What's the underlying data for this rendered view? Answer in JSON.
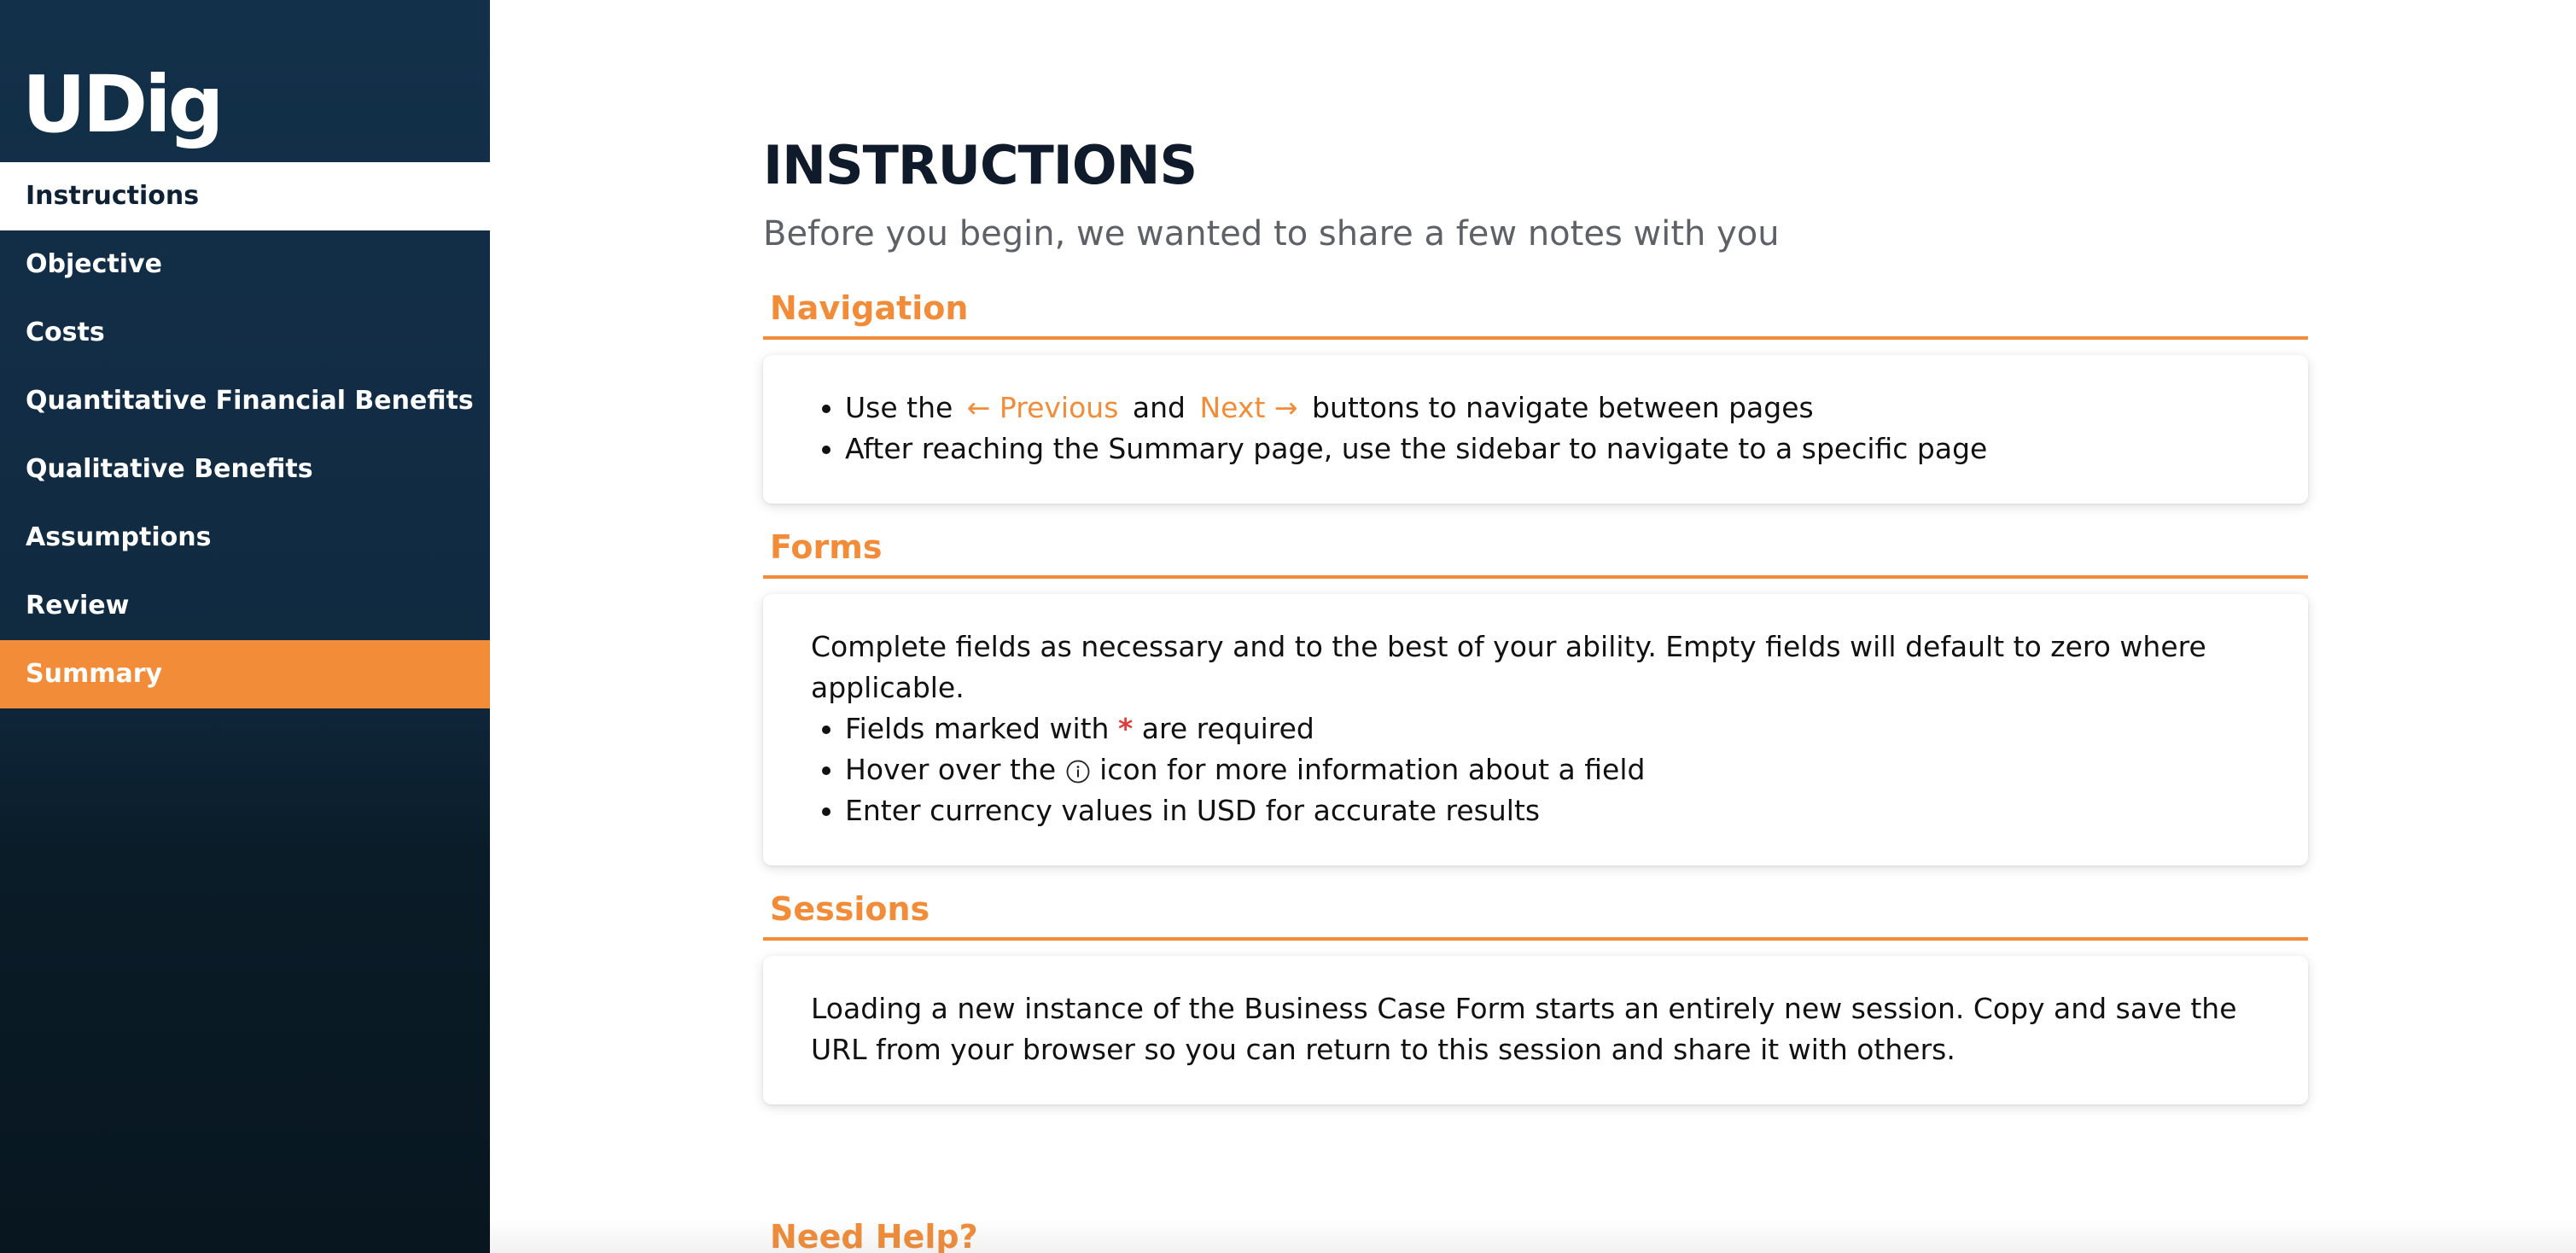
{
  "sidebar": {
    "logo": "UDig",
    "items": [
      {
        "label": "Instructions"
      },
      {
        "label": "Objective"
      },
      {
        "label": "Costs"
      },
      {
        "label": "Quantitative Financial Benefits"
      },
      {
        "label": "Qualitative Benefits"
      },
      {
        "label": "Assumptions"
      },
      {
        "label": "Review"
      },
      {
        "label": "Summary"
      }
    ]
  },
  "main": {
    "title": "INSTRUCTIONS",
    "subtitle": "Before you begin, we wanted to share a few notes with you",
    "navigation": {
      "header": "Navigation",
      "line1_prefix": "Use the",
      "previous_label": "← Previous",
      "line1_and": "and",
      "next_label": "Next →",
      "line1_suffix": "buttons to navigate between pages",
      "line2": "After reaching the Summary page, use the sidebar to navigate to a specific page"
    },
    "forms": {
      "header": "Forms",
      "intro": "Complete fields as necessary and to the best of your ability. Empty fields will default to zero where applicable.",
      "required_prefix": "Fields marked with",
      "required_star": "*",
      "required_suffix": "are required",
      "hover_prefix": "Hover over the",
      "hover_suffix": "icon for more information about a field",
      "currency": "Enter currency values in USD for accurate results"
    },
    "sessions": {
      "header": "Sessions",
      "text": "Loading a new instance of the Business Case Form starts an entirely new session. Copy and save the URL from your browser so you can return to this session and share it with others."
    },
    "help": {
      "header": "Need Help?"
    }
  },
  "colors": {
    "sidebar_bg": "#13304a",
    "accent": "#f28c38",
    "required": "#e23b3b",
    "text": "#111111"
  },
  "icons": {
    "info": "info-circle-icon"
  }
}
